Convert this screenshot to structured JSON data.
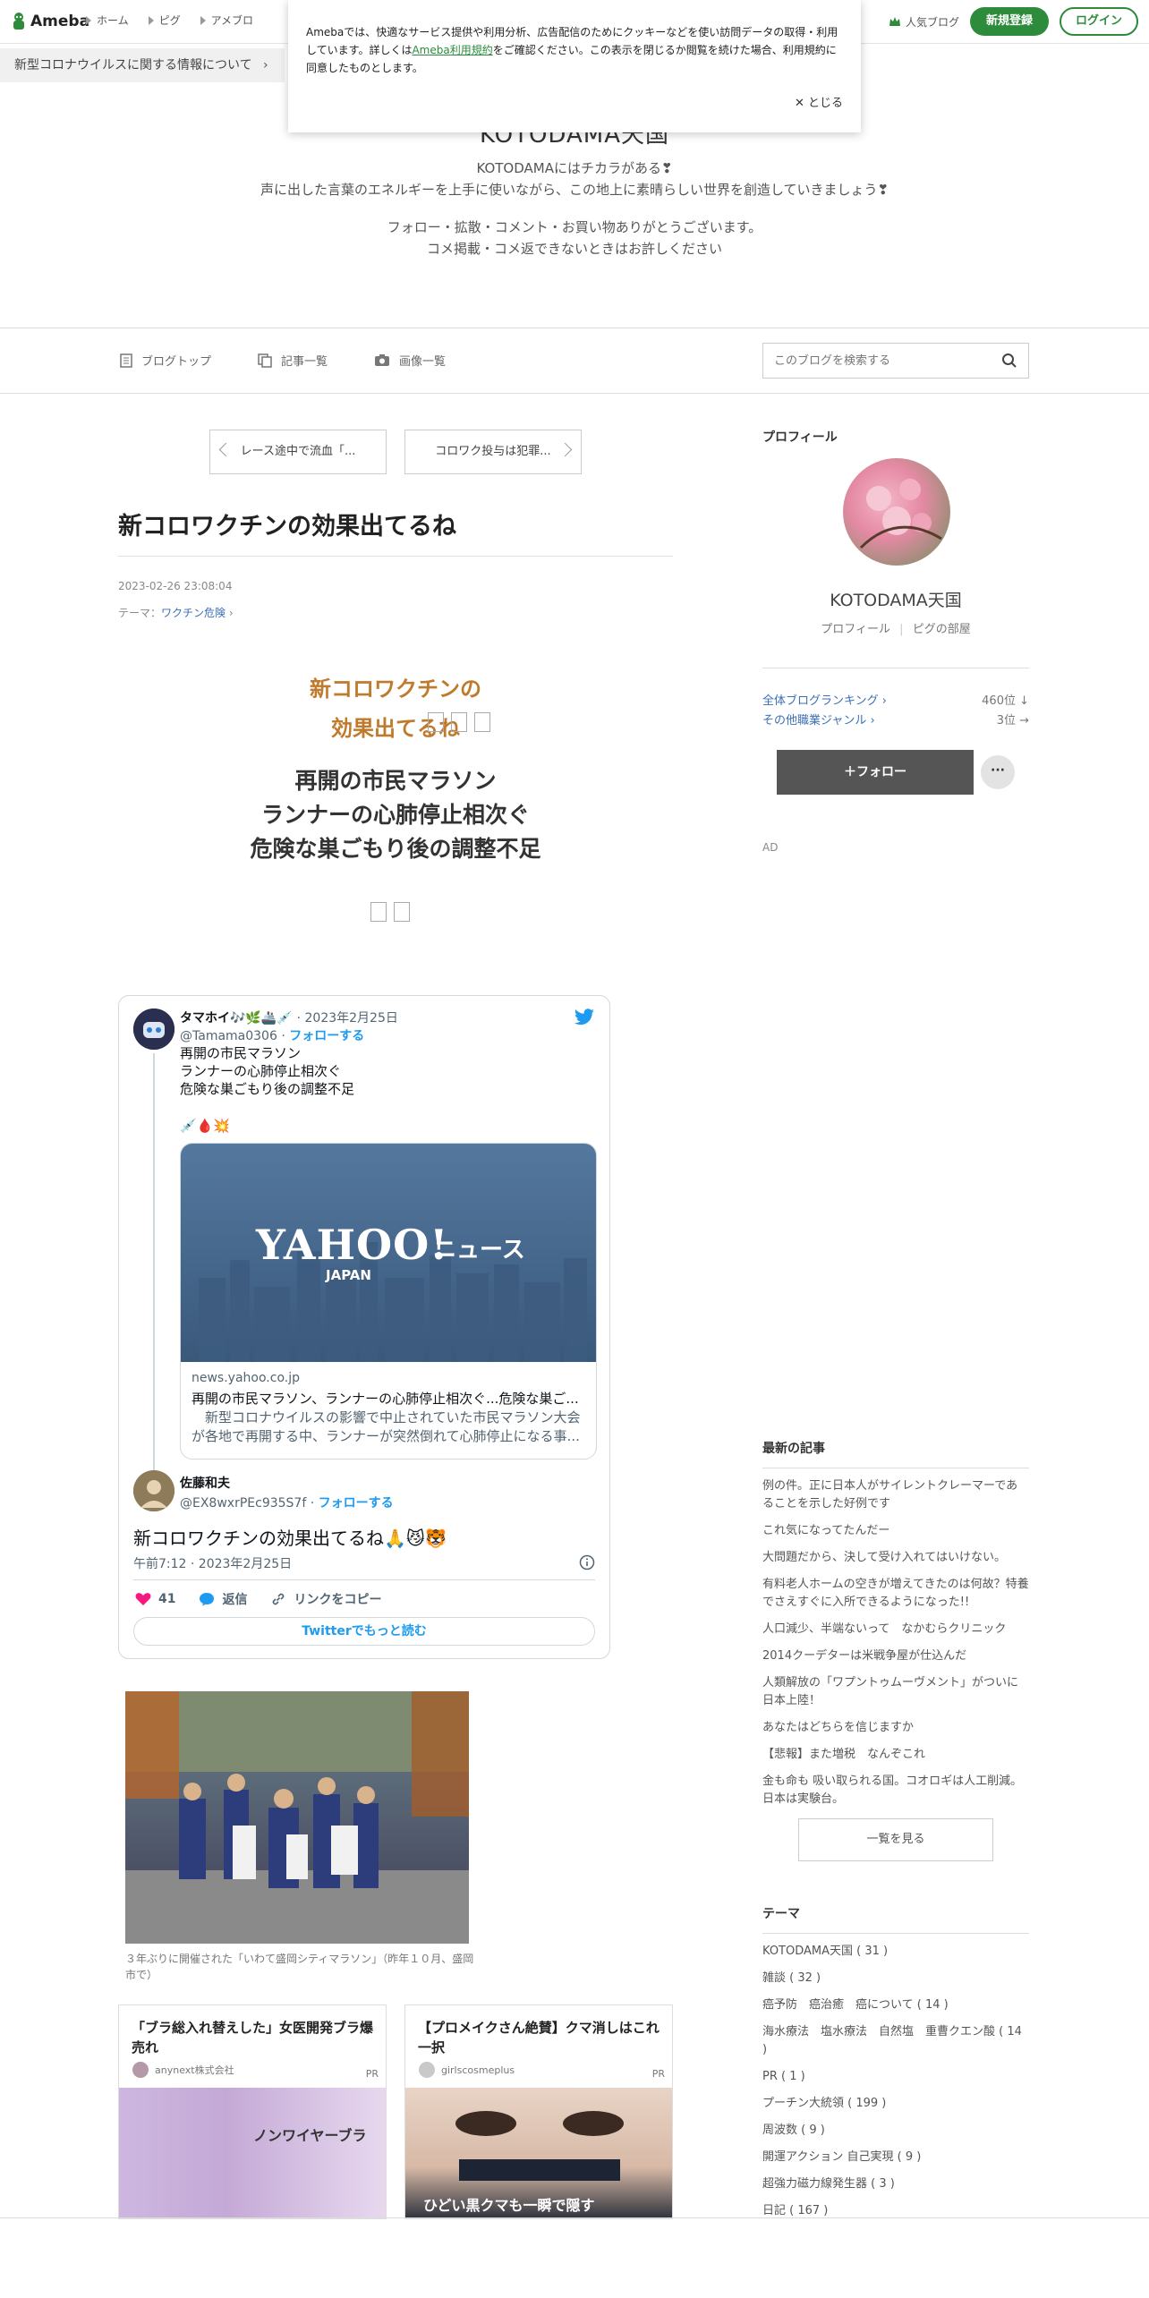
{
  "global_header": {
    "logo": "Ameba",
    "nav": [
      "ホーム",
      "ピグ",
      "アメブロ"
    ],
    "popular": "人気ブログ",
    "signup": "新規登録",
    "login": "ログイン"
  },
  "corona_notice": "新型コロナウイルスに関する情報について",
  "cookie_banner": {
    "text_before": "Amebaでは、快適なサービス提供や利用分析、広告配信のためにクッキーなどを使い訪問データの取得・利用しています。詳しくは",
    "link": "Ameba利用規約",
    "text_after": "をご確認ください。この表示を閉じるか閲覧を続けた場合、利用規約に同意したものとします。",
    "close": "とじる"
  },
  "blog": {
    "title": "KOTODAMA天国",
    "description": "KOTODAMAにはチカラがある❣\n声に出した言葉のエネルギーを上手に使いながら、この地上に素晴らしい世界を創造していきましょう❣",
    "notice": "フォロー・拡散・コメント・お買い物ありがとうございます。\nコメ掲載・コメ返できないときはお許しください"
  },
  "blog_menu": {
    "top": "ブログトップ",
    "entries": "記事一覧",
    "images": "画像一覧",
    "search_placeholder": "このブログを検索する"
  },
  "pager": {
    "prev": "レース途中で流血「...",
    "next": "コロワク投与は犯罪..."
  },
  "article": {
    "title": "新コロワクチンの効果出てるね",
    "date": "2023-02-26 23:08:04",
    "theme_label": "テーマ：",
    "theme": "ワクチン危険",
    "headline1": "新コロワクチンの\n効果出てるね",
    "headline2": "再開の市民マラソン\nランナーの心肺停止相次ぐ\n危険な巣ごもり後の調整不足",
    "photo_caption": "３年ぶりに開催された「いわて盛岡シティマラソン」（昨年１０月、盛岡市で）"
  },
  "tweet": {
    "author": "タマホイ🎶🌿🚢💉",
    "date": "2023年2月25日",
    "handle": "@Tamama0306",
    "follow": "フォローする",
    "text": "再開の市民マラソン\nランナーの心肺停止相次ぐ\n危険な巣ごもり後の調整不足",
    "emoji_line": "💉🩸💥",
    "card": {
      "brand": "YAHOO!",
      "brand_sub": "JAPAN",
      "brand_news": "ニュース",
      "domain": "news.yahoo.co.jp",
      "title": "再開の市民マラソン、ランナーの心肺停止相次ぐ...危険な巣ご...",
      "desc": "　新型コロナウイルスの影響で中止されていた市民マラソン大会が各地で再開する中、ランナーが突然倒れて心肺停止になる事..."
    },
    "quote_author": "佐藤和夫",
    "quote_handle": "@EX8wxrPEc935S7f",
    "quote_follow": "フォローする",
    "main_text": "新コロワクチンの効果出てるね🙏😼🐯",
    "time": "午前7:12 · 2023年2月25日",
    "likes": "41",
    "reply": "返信",
    "copy_link": "リンクをコピー",
    "read_more": "Twitterでもっと読む"
  },
  "pr_cards": [
    {
      "title": "「ブラ総入れ替えした」女医開発ブラ爆売れ",
      "source": "anynext株式会社",
      "badge": "PR",
      "img_text": "ノンワイヤーブラ"
    },
    {
      "title": "【プロメイクさん絶賛】クマ消しはこれ一択",
      "source": "girlscosmeplus",
      "badge": "PR",
      "img_text": "ひどい黒クマも一瞬で隠す"
    }
  ],
  "sidebar": {
    "profile_heading": "プロフィール",
    "profile_name": "KOTODAMA天国",
    "profile_link": "プロフィール",
    "pig_link": "ピグの部屋",
    "rank_all_label": "全体ブログランキング",
    "rank_all_value": "460位 ↓",
    "rank_genre_label": "その他職業ジャンル",
    "rank_genre_value": "3位 →",
    "follow": "＋フォロー",
    "more": "···",
    "ad": "AD",
    "recent_heading": "最新の記事",
    "recent": [
      "例の件。正に日本人がサイレントクレーマーであることを示した好例です",
      "これ気になってたんだー",
      "大問題だから、決して受け入れてはいけない。",
      "有料老人ホームの空きが増えてきたのは何故？特養でさえすぐに入所できるようになった!!",
      "人口減少、半端ないって　なかむらクリニック",
      "2014クーデターは米戦争屋が仕込んだ",
      "人類解放の「ワプントゥムーヴメント」がついに日本上陸！",
      "あなたはどちらを信じますか",
      "【悲報】また増税　なんぞこれ",
      "金も命も 吸い取られる国。コオロギは人工削減。日本は実験台。"
    ],
    "see_all": "一覧を見る",
    "themes_heading": "テーマ",
    "themes": [
      "KOTODAMA天国 ( 31 )",
      "雑談 ( 32 )",
      "癌予防　癌治癒　癌について ( 14 )",
      "海水療法　塩水療法　自然塩　重曹クエン酸 ( 14 )",
      "PR ( 1 )",
      "プーチン大統領 ( 199 )",
      "周波数 ( 9 )",
      "開運アクション 自己実現 ( 9 )",
      "超強力磁力線発生器 ( 3 )",
      "日記 ( 167 )"
    ]
  },
  "colors": {
    "brand_green": "#2d8c3c",
    "headline_orange": "#c07a2c",
    "link_blue": "#3b6fb6",
    "twitter_blue": "#1d9bf0"
  }
}
